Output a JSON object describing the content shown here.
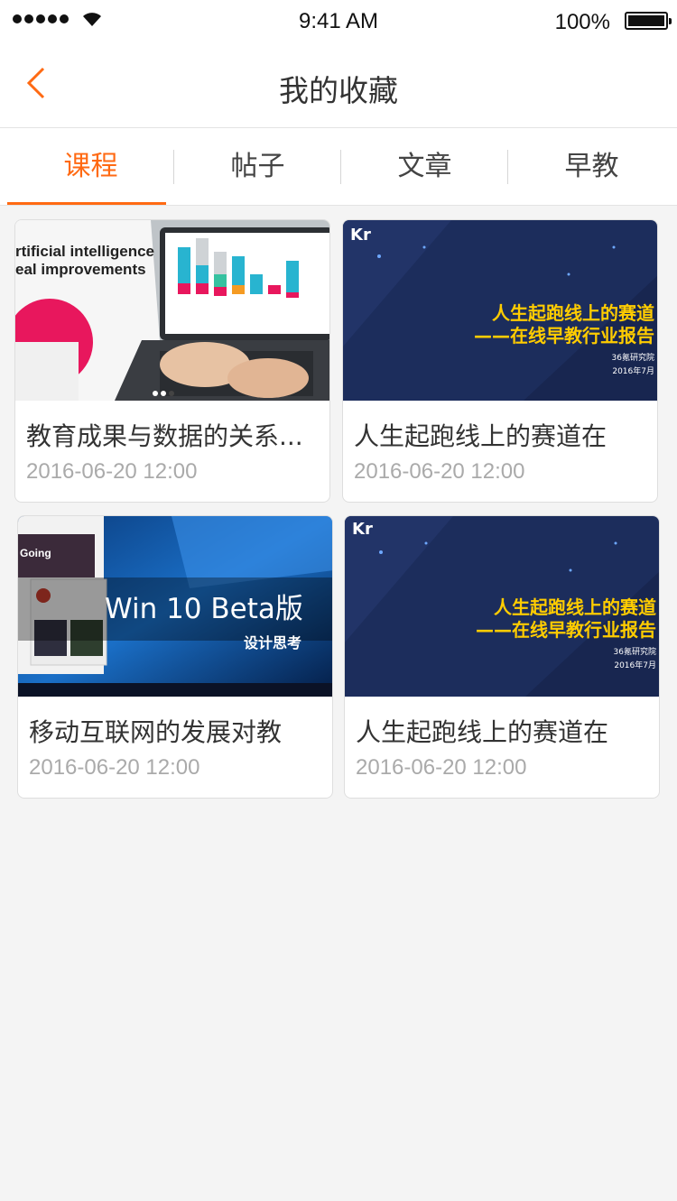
{
  "status": {
    "time": "9:41 AM",
    "battery": "100%"
  },
  "header": {
    "title": "我的收藏"
  },
  "tabs": [
    {
      "label": "课程",
      "active": true
    },
    {
      "label": "帖子",
      "active": false
    },
    {
      "label": "文章",
      "active": false
    },
    {
      "label": "早教",
      "active": false
    }
  ],
  "cards": [
    {
      "title": "教育成果与数据的关系...",
      "date": "2016-06-20 12:00",
      "thumb_text_1": "rtificial intelligence",
      "thumb_text_2": "eal improvements"
    },
    {
      "title": "人生起跑线上的赛道在",
      "date": "2016-06-20 12:00",
      "thumb_text_1": "人生起跑线上的赛道",
      "thumb_text_2": "——在线早教行业报告",
      "thumb_text_3": "36氪研究院",
      "thumb_text_4": "2016年7月",
      "thumb_logo": "Kr"
    },
    {
      "title": "移动互联网的发展对教",
      "date": "2016-06-20 12:00",
      "thumb_text_1": "Win 10 Beta版",
      "thumb_text_2": "设计思考"
    },
    {
      "title": "人生起跑线上的赛道在",
      "date": "2016-06-20 12:00",
      "thumb_text_1": "人生起跑线上的赛道",
      "thumb_text_2": "——在线早教行业报告",
      "thumb_text_3": "36氪研究院",
      "thumb_text_4": "2016年7月",
      "thumb_logo": "Kr"
    }
  ],
  "colors": {
    "accent": "#ff6a13",
    "background": "#f4f4f4"
  }
}
